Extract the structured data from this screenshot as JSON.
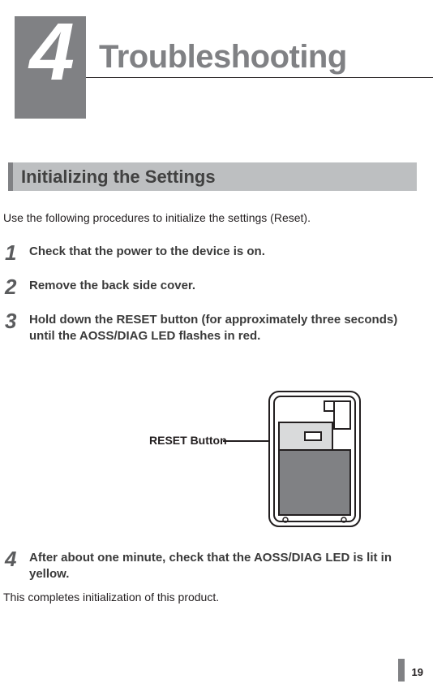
{
  "chapter": {
    "number": "4",
    "title": "Troubleshooting"
  },
  "section": {
    "title": "Initializing the Settings"
  },
  "intro": "Use the following procedures to initialize the settings (Reset).",
  "steps": [
    {
      "num": "1",
      "text": "Check that the power to the device is on."
    },
    {
      "num": "2",
      "text": "Remove the back side cover."
    },
    {
      "num": "3",
      "text": "Hold down the RESET button (for approximately three seconds) until the AOSS/DIAG LED flashes in red."
    },
    {
      "num": "4",
      "text": "After about one minute, check that the AOSS/DIAG LED is lit in yellow."
    }
  ],
  "diagram": {
    "reset_label": "RESET Button"
  },
  "outro": "This completes initialization of this product.",
  "page_number": "19"
}
